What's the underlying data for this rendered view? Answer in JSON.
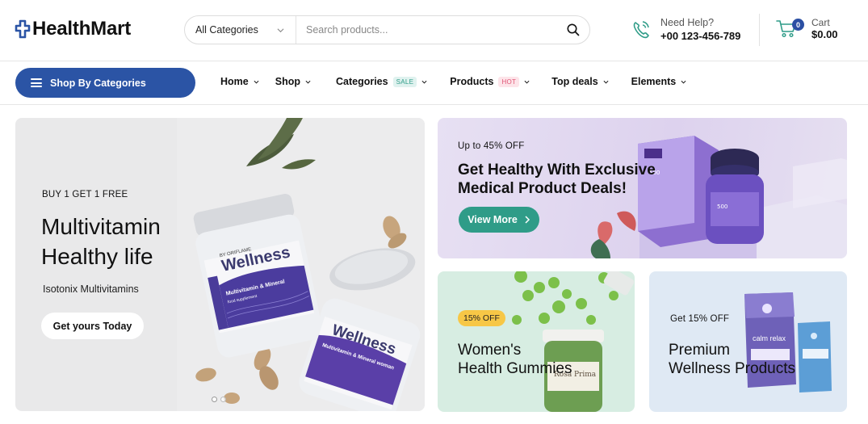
{
  "brand": {
    "name": "HealthMart",
    "accent": "#2b54a5",
    "teal": "#2f9c88"
  },
  "search": {
    "category": "All Categories",
    "placeholder": "Search products..."
  },
  "help": {
    "label": "Need Help?",
    "phone": "+00 123-456-789"
  },
  "cart": {
    "label": "Cart",
    "amount": "$0.00",
    "count": "0"
  },
  "nav": {
    "shop_by_categories": "Shop By Categories",
    "items": [
      {
        "label": "Home"
      },
      {
        "label": "Shop"
      },
      {
        "label": "Categories",
        "tag": "SALE"
      },
      {
        "label": "Products",
        "tag": "HOT"
      },
      {
        "label": "Top deals"
      },
      {
        "label": "Elements"
      }
    ]
  },
  "hero": {
    "eyebrow": "BUY 1 GET 1 FREE",
    "title_line1": "Multivitamin",
    "title_line2": "Healthy life",
    "subtitle": "Isotonix Multivitamins",
    "button": "Get yours Today",
    "jar_brand": "Wellness",
    "jar_by": "BY ORIFLAME",
    "jar_product": "Multivitamin & Mineral",
    "jar_women": "Multivitamin & Mineral woman",
    "jar_food": "food supplement"
  },
  "promo_top": {
    "eyebrow": "Up to 45% OFF",
    "title_line1": "Get Healthy With Exclusive",
    "title_line2": "Medical Product Deals!",
    "button": "View More"
  },
  "promo_gummies": {
    "badge": "15% OFF",
    "title_line1": "Women's",
    "title_line2": "Health Gummies",
    "jar_label": "Rosa Prima"
  },
  "promo_wellness": {
    "eyebrow": "Get 15% OFF",
    "title_line1": "Premium",
    "title_line2": "Wellness Products",
    "pouch_label": "calm relax"
  }
}
